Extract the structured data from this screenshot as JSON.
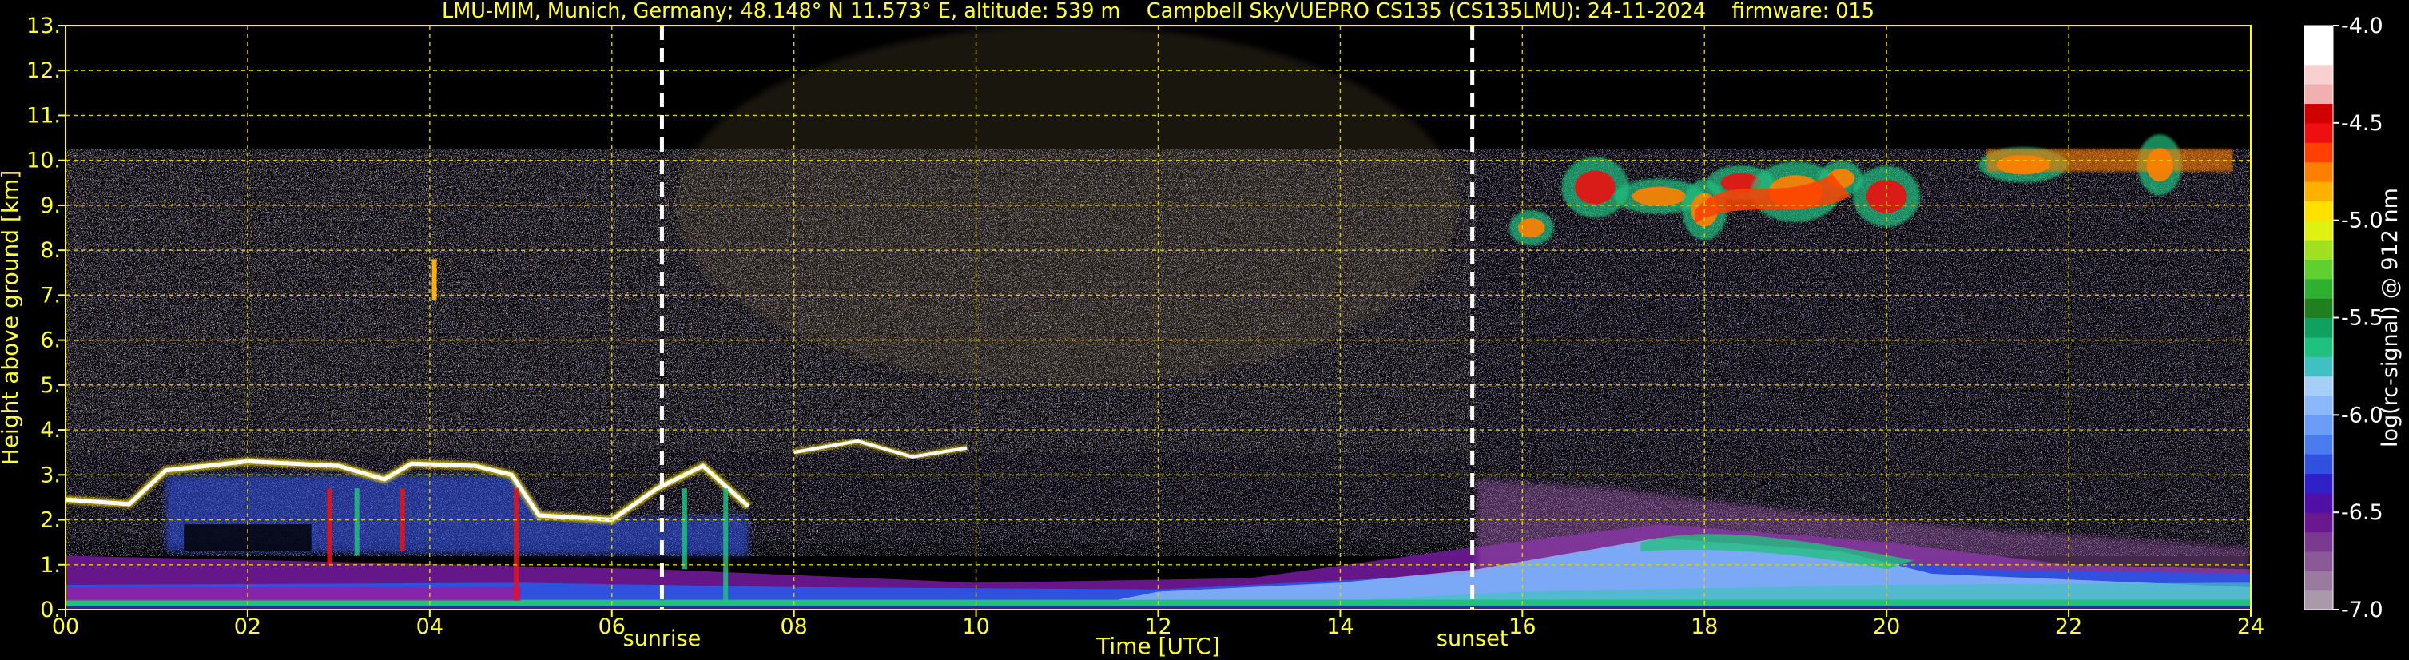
{
  "chart_data": {
    "type": "heatmap",
    "title": "LMU-MIM, Munich, Germany; 48.148° N 11.573° E, altitude: 539 m    Campbell SkyVUEPRO CS135 (CS135LMU): 24-11-2024    firmware: 015",
    "xlabel": "Time [UTC]",
    "ylabel": "Height above ground [km]",
    "xlim": [
      0,
      24
    ],
    "ylim": [
      0,
      13
    ],
    "x_ticks": [
      0,
      2,
      4,
      6,
      8,
      10,
      12,
      14,
      16,
      18,
      20,
      22,
      24
    ],
    "x_tick_labels": [
      "00",
      "02",
      "04",
      "06",
      "08",
      "10",
      "12",
      "14",
      "16",
      "18",
      "20",
      "22",
      "24"
    ],
    "y_ticks": [
      0,
      1,
      2,
      3,
      4,
      5,
      6,
      7,
      8,
      9,
      10,
      11,
      12,
      13
    ],
    "y_tick_labels": [
      "0.",
      "1.",
      "2.",
      "3.",
      "4.",
      "5.",
      "6.",
      "7.",
      "8.",
      "9.",
      "10.",
      "11.",
      "12.",
      "13."
    ],
    "grid": true,
    "data_top_km": 10.25,
    "annotations": [
      {
        "label": "sunrise",
        "time_utc": 6.55
      },
      {
        "label": "sunset",
        "time_utc": 15.45
      }
    ],
    "colorbar": {
      "label": "log(rc-signal) @ 912 nm",
      "range": [
        -7.0,
        -4.0
      ],
      "ticks": [
        -4.0,
        -4.5,
        -5.0,
        -5.5,
        -6.0,
        -6.5,
        -7.0
      ],
      "tick_labels": [
        "-4.0",
        "-4.5",
        "-5.0",
        "-5.5",
        "-6.0",
        "-6.5",
        "-7.0"
      ],
      "colors": [
        "#a89aa8",
        "#9a7a9e",
        "#8a5a96",
        "#7a3a90",
        "#6a1890",
        "#5010a8",
        "#3020c8",
        "#3050e0",
        "#4a7cf0",
        "#6a9cf8",
        "#8ab8f8",
        "#a6cff8",
        "#40c0c0",
        "#20c080",
        "#10a060",
        "#208020",
        "#30b030",
        "#60d030",
        "#a0e020",
        "#e0f010",
        "#ffe000",
        "#ffb000",
        "#ff8000",
        "#ff4000",
        "#ee1010",
        "#d00000",
        "#f0b0b0",
        "#f8d0d0",
        "#ffffff",
        "#ffffff"
      ]
    },
    "features": {
      "cloud_base_layer_km": [
        [
          0.0,
          2.45
        ],
        [
          0.7,
          2.35
        ],
        [
          1.1,
          3.1
        ],
        [
          2.0,
          3.3
        ],
        [
          3.0,
          3.2
        ],
        [
          3.5,
          2.9
        ],
        [
          3.8,
          3.25
        ],
        [
          4.5,
          3.2
        ],
        [
          4.9,
          3.0
        ],
        [
          5.2,
          2.1
        ],
        [
          6.0,
          2.0
        ],
        [
          6.5,
          2.7
        ],
        [
          7.0,
          3.2
        ],
        [
          7.5,
          2.3
        ]
      ],
      "midlevel_cloud_km": [
        [
          8.0,
          3.5
        ],
        [
          8.7,
          3.75
        ],
        [
          9.3,
          3.4
        ],
        [
          9.9,
          3.6
        ]
      ],
      "high_cloud_segments": [
        [
          16.1,
          8.5
        ],
        [
          16.8,
          9.4
        ],
        [
          17.5,
          9.2
        ],
        [
          18.0,
          8.9
        ],
        [
          18.4,
          9.5
        ],
        [
          19.0,
          9.3
        ],
        [
          19.5,
          9.6
        ],
        [
          20.0,
          9.2
        ],
        [
          21.5,
          9.9
        ],
        [
          23.0,
          9.9
        ]
      ],
      "boundary_layer_top_km": [
        [
          0,
          1.2
        ],
        [
          6.5,
          0.9
        ],
        [
          10,
          0.6
        ],
        [
          13,
          0.7
        ],
        [
          15.5,
          1.4
        ],
        [
          17.5,
          1.9
        ],
        [
          20,
          1.5
        ],
        [
          22,
          1.0
        ],
        [
          24,
          0.9
        ]
      ]
    }
  }
}
